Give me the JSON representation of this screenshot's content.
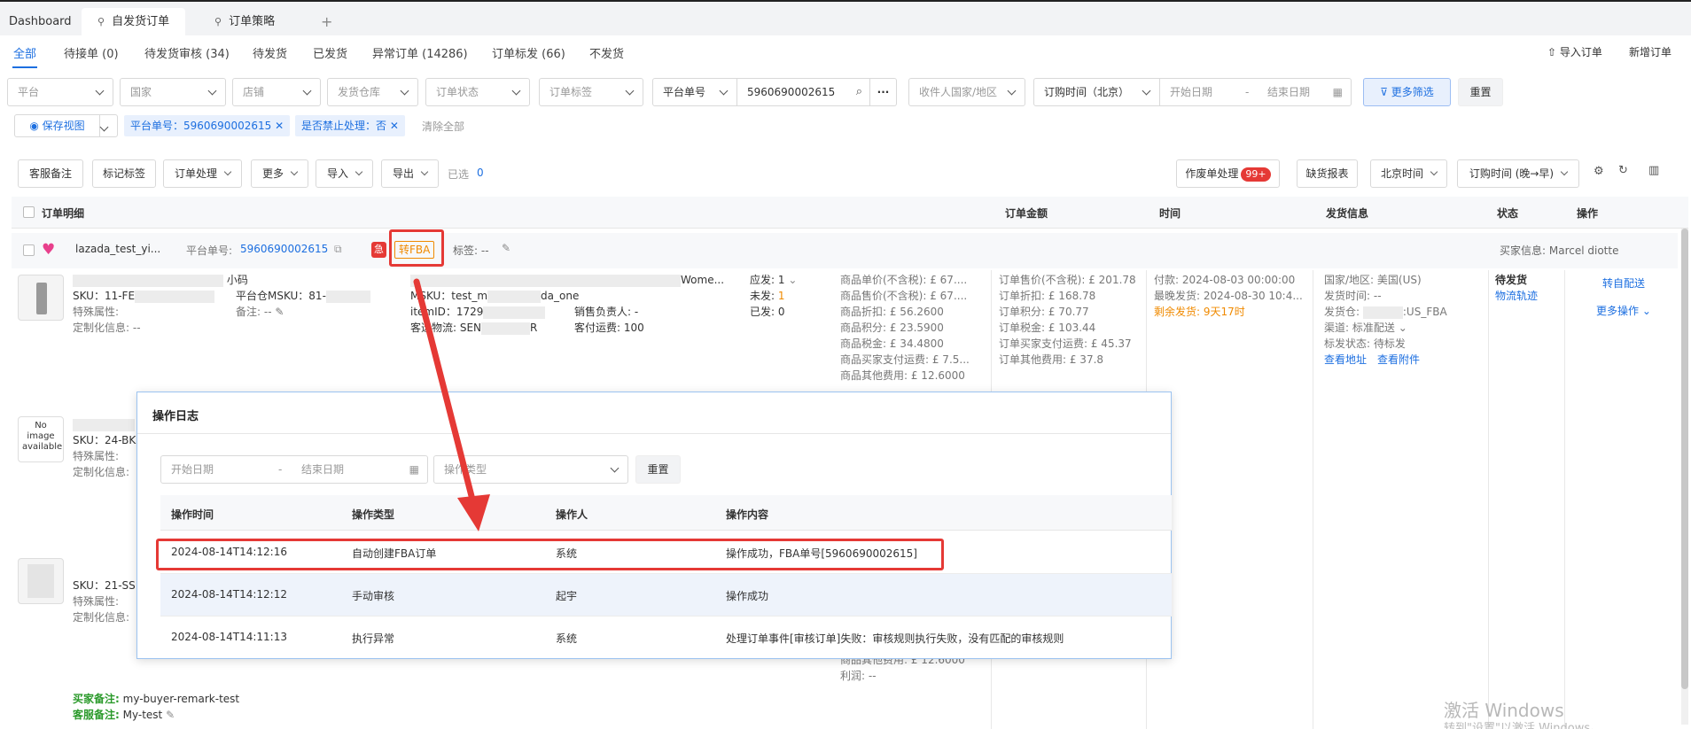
{
  "top_tabs": [
    {
      "label": "Dashboard"
    },
    {
      "label": "自发货订单"
    },
    {
      "label": "订单策略"
    },
    {
      "label": "+"
    }
  ],
  "status_tabs": [
    {
      "label": "全部"
    },
    {
      "label": "待接单 (0)"
    },
    {
      "label": "待发货审核 (34)"
    },
    {
      "label": "待发货"
    },
    {
      "label": "已发货"
    },
    {
      "label": "异常订单 (14286)"
    },
    {
      "label": "订单标发 (66)"
    },
    {
      "label": "不发货"
    }
  ],
  "header_actions": {
    "import": "导入订单",
    "new": "新增订单"
  },
  "filters": {
    "platform": "平台",
    "country": "国家",
    "shop": "店铺",
    "warehouse": "发货仓库",
    "order_status": "订单状态",
    "order_tag": "订单标签",
    "order_no_type": "平台单号",
    "order_no_value": "5960690002615",
    "more_icon": "···",
    "recipient_country": "收件人国家/地区",
    "order_time": "订购时间（北京）",
    "start_date": "开始日期",
    "dash": "-",
    "end_date": "结束日期",
    "more_filter": "更多筛选",
    "reset": "重置"
  },
  "save_view": {
    "label": "保存视图"
  },
  "active_tags": [
    {
      "label": "平台单号：5960690002615"
    },
    {
      "label": "是否禁止处理：否"
    }
  ],
  "clear_all": "清除全部",
  "toolbar": {
    "cs_note": "客服备注",
    "mark_tag": "标记标签",
    "order_process": "订单处理",
    "more": "更多",
    "import": "导入",
    "export": "导出",
    "selected_label": "已选",
    "selected_count": "0",
    "void_process": "作废单处理",
    "void_badge": "99+",
    "shortage_report": "缺货报表",
    "timezone": "北京时间",
    "sort": "订购时间 (晚→早)"
  },
  "table_headers": {
    "detail": "订单明细",
    "amount": "订单金额",
    "time": "时间",
    "shipping": "发货信息",
    "status": "状态",
    "ops": "操作"
  },
  "order": {
    "shop": "lazada_test_yi...",
    "platform_no_label": "平台单号:",
    "platform_no": "5960690002615",
    "urgent": "急",
    "to_fba": "转FBA",
    "tag_label": "标签: --",
    "buyer_info": "买家信息: Marcel diotte",
    "item1": {
      "name_suffix": "小码",
      "sku": "SKU：11-FE",
      "attr": "特殊属性:",
      "custom": "定制化信息: --",
      "msku_platform": "平台仓MSKU：81-",
      "remark": "备注: --",
      "title_suffix": "Wome...",
      "msku": "MSKU：test_m",
      "msku_suffix": "da_one",
      "item_id": "itemID：1729",
      "sales_owner": "销售负责人: -",
      "logistics": "客选物流: SEN",
      "logistics_suffix": "R",
      "shipping_fee": "客付运费: 100",
      "should_ship_label": "应发:",
      "should_ship": "1",
      "unshipped_label": "未发:",
      "unshipped": "1",
      "shipped_label": "已发:",
      "shipped": "0",
      "price_lines": [
        "商品单价(不含税): £ 67....",
        "商品售价(不含税): £ 67....",
        "商品折扣: £ 56.2600",
        "商品积分: £ 23.5900",
        "商品税金: £ 34.4800",
        "商品买家支付运费: £ 7.5...",
        "商品其他费用: £ 12.6000"
      ]
    },
    "item2": {
      "no_image_line1": "No image",
      "no_image_line2": "available",
      "sku": "SKU：24-BK",
      "attr": "特殊属性:",
      "custom": "定制化信息:"
    },
    "item3": {
      "sku": "SKU：21-SS",
      "attr": "特殊属性:",
      "custom": "定制化信息:",
      "other_fee": "商品其他费用: £ 12.6000",
      "profit": "利润: --"
    },
    "amount_lines": [
      "订单售价(不含税): £ 201.78",
      "订单折扣: £ 168.78",
      "订单积分: £ 70.77",
      "订单税金: £ 103.44",
      "订单买家支付运费: £ 45.37",
      "订单其他费用: £ 37.8"
    ],
    "time": {
      "paid": "付款: 2024-08-03 00:00:00",
      "latest_ship": "最晚发货: 2024-08-30 10:4...",
      "remaining": "剩余发货: 9天17时"
    },
    "shipping": {
      "country": "国家/地区: 美国(US)",
      "ship_time": "发货时间: --",
      "warehouse_prefix": "发货仓:",
      "warehouse_suffix": ":US_FBA",
      "channel": "渠道: 标准配送",
      "mark_status": "标发状态: 待标发",
      "view_address": "查看地址",
      "view_attachment": "查看附件"
    },
    "status": {
      "label": "待发货",
      "track": "物流轨迹"
    },
    "ops": {
      "to_self": "转自配送",
      "more": "更多操作"
    },
    "buyer_remark_label": "买家备注:",
    "buyer_remark": "my-buyer-remark-test",
    "cs_remark_label": "客服备注:",
    "cs_remark": "My-test"
  },
  "modal": {
    "title": "操作日志",
    "start_date": "开始日期",
    "dash": "-",
    "end_date": "结束日期",
    "op_type_placeholder": "操作类型",
    "reset": "重置",
    "headers": [
      "操作时间",
      "操作类型",
      "操作人",
      "操作内容"
    ],
    "rows": [
      {
        "time": "2024-08-14T14:12:16",
        "type": "自动创建FBA订单",
        "operator": "系统",
        "content": "操作成功，FBA单号[5960690002615]"
      },
      {
        "time": "2024-08-14T14:12:12",
        "type": "手动审核",
        "operator": "起宇",
        "content": "操作成功"
      },
      {
        "time": "2024-08-14T14:11:13",
        "type": "执行异常",
        "operator": "系统",
        "content": "处理订单事件[审核订单]失败：审核规则执行失败，没有匹配的审核规则"
      }
    ]
  },
  "watermark": {
    "line1": "激活 Windows",
    "line2": "转到\"设置\"以激活 Windows。"
  },
  "colors": {
    "accent": "#1d6fe0",
    "warning": "#f08a00",
    "danger": "#e53935",
    "arrow": "#e53935"
  }
}
